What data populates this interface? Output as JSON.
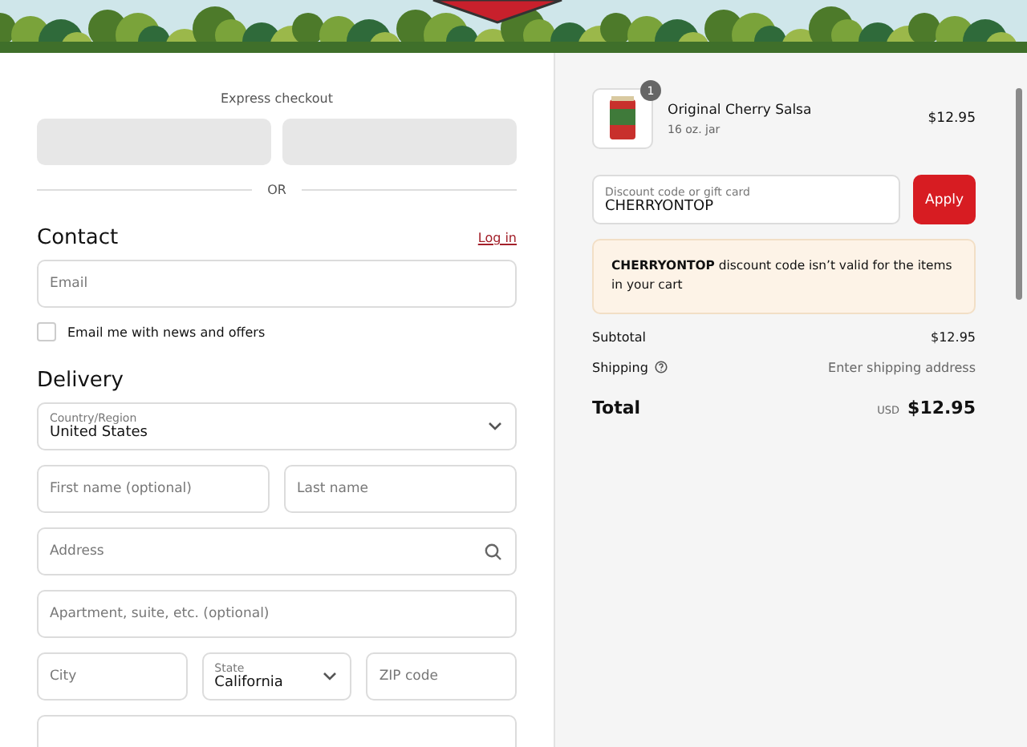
{
  "express_checkout": {
    "label": "Express checkout",
    "divider": "OR"
  },
  "contact": {
    "heading": "Contact",
    "login_link": "Log in",
    "email": {
      "placeholder": "Email"
    },
    "newsletter": {
      "label": "Email me with news and offers",
      "checked": false
    }
  },
  "delivery": {
    "heading": "Delivery",
    "rows": [
      [
        {
          "kind": "select",
          "label": "Country/Region",
          "value": "United States"
        }
      ],
      [
        {
          "kind": "text",
          "placeholder": "First name (optional)"
        },
        {
          "kind": "text",
          "placeholder": "Last name"
        }
      ],
      [
        {
          "kind": "search",
          "placeholder": "Address"
        }
      ],
      [
        {
          "kind": "text",
          "placeholder": "Apartment, suite, etc. (optional)"
        }
      ],
      [
        {
          "kind": "text",
          "placeholder": "City"
        },
        {
          "kind": "select",
          "label": "State",
          "value": "California"
        },
        {
          "kind": "text",
          "placeholder": "ZIP code"
        }
      ],
      [
        {
          "kind": "text"
        }
      ]
    ]
  },
  "summary": {
    "items": [
      {
        "name": "Original Cherry Salsa",
        "variant": "16 oz. jar",
        "price": "$12.95",
        "quantity": "1"
      }
    ],
    "discount": {
      "label": "Discount code or gift card",
      "value": "CHERRYONTOP",
      "button": "Apply"
    },
    "notice": "**CHERRYONTOP** discount code isn’t valid for the items in your cart",
    "lines": [
      {
        "kind": "plain",
        "label": "Subtotal",
        "value": "$12.95"
      },
      {
        "kind": "help",
        "label": "Shipping",
        "value": "Enter shipping address"
      }
    ],
    "total": {
      "label": "Total",
      "currency": "USD",
      "amount": "$12.95"
    }
  }
}
